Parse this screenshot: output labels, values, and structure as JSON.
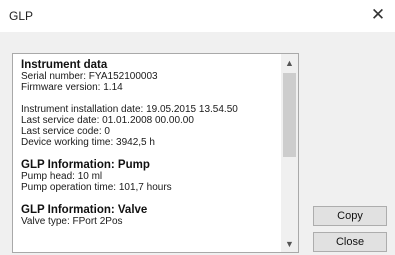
{
  "window": {
    "title": "GLP",
    "close_glyph": "✕"
  },
  "sections": [
    {
      "heading": "Instrument data",
      "lines": [
        "Serial number: FYA152100003",
        "Firmware version: 1.14",
        "",
        "Instrument installation date: 19.05.2015 13.54.50",
        "Last service date: 01.01.2008 00.00.00",
        "Last service code: 0",
        "Device working time: 3942,5 h"
      ]
    },
    {
      "heading": "GLP Information: Pump",
      "lines": [
        "Pump head: 10 ml",
        "Pump operation time: 101,7 hours"
      ]
    },
    {
      "heading": "GLP Information: Valve",
      "lines": [
        "Valve type: FPort 2Pos"
      ]
    }
  ],
  "scrollbar": {
    "up_glyph": "▲",
    "down_glyph": "▼"
  },
  "buttons": {
    "copy_label": "Copy",
    "close_label": "Close"
  }
}
